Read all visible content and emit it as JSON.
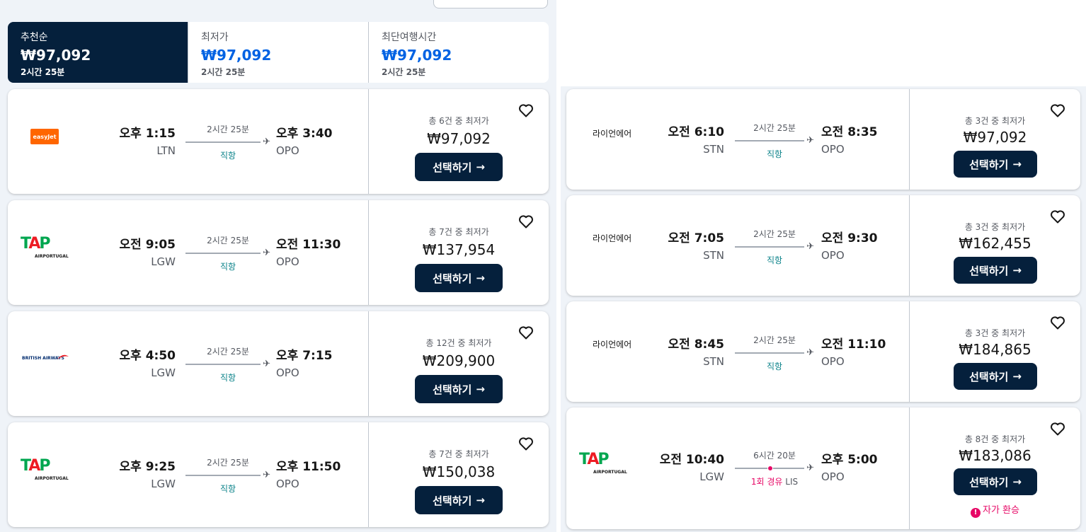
{
  "sort_tabs": [
    {
      "label": "추천순",
      "price": "₩97,092",
      "duration": "2시간 25분"
    },
    {
      "label": "최저가",
      "price": "₩97,092",
      "duration": "2시간 25분"
    },
    {
      "label": "최단여행시간",
      "price": "₩97,092",
      "duration": "2시간 25분"
    }
  ],
  "select_label": "선택하기",
  "left_flights": [
    {
      "airline": "easyJet",
      "logo": "easyjet-logo",
      "dep_time": "오후 1:15",
      "dep_airport": "LTN",
      "duration": "2시간 25분",
      "stops": "직항",
      "arr_time": "오후 3:40",
      "arr_airport": "OPO",
      "deal": "총 6건 중 최저가",
      "price": "₩97,092"
    },
    {
      "airline": "TAP",
      "logo": "tap-logo",
      "logo_sub": "AIRPORTUGAL",
      "dep_time": "오전 9:05",
      "dep_airport": "LGW",
      "duration": "2시간 25분",
      "stops": "직항",
      "arr_time": "오전 11:30",
      "arr_airport": "OPO",
      "deal": "총 7건 중 최저가",
      "price": "₩137,954"
    },
    {
      "airline": "BRITISH AIRWAYS",
      "logo": "british-airways-logo",
      "dep_time": "오후 4:50",
      "dep_airport": "LGW",
      "duration": "2시간 25분",
      "stops": "직항",
      "arr_time": "오후 7:15",
      "arr_airport": "OPO",
      "deal": "총 12건 중 최저가",
      "price": "₩209,900"
    },
    {
      "airline": "TAP",
      "logo": "tap-logo",
      "logo_sub": "AIRPORTUGAL",
      "dep_time": "오후 9:25",
      "dep_airport": "LGW",
      "duration": "2시간 25분",
      "stops": "직항",
      "arr_time": "오후 11:50",
      "arr_airport": "OPO",
      "deal": "총 7건 중 최저가",
      "price": "₩150,038"
    }
  ],
  "right_flights": [
    {
      "airline": "라이언에어",
      "dep_time": "오전 6:10",
      "dep_airport": "STN",
      "duration": "2시간 25분",
      "stops": "직항",
      "arr_time": "오전 8:35",
      "arr_airport": "OPO",
      "deal": "총 3건 중 최저가",
      "price": "₩97,092"
    },
    {
      "airline": "라이언에어",
      "dep_time": "오전 7:05",
      "dep_airport": "STN",
      "duration": "2시간 25분",
      "stops": "직항",
      "arr_time": "오전 9:30",
      "arr_airport": "OPO",
      "deal": "총 3건 중 최저가",
      "price": "₩162,455"
    },
    {
      "airline": "라이언에어",
      "dep_time": "오전 8:45",
      "dep_airport": "STN",
      "duration": "2시간 25분",
      "stops": "직항",
      "arr_time": "오전 11:10",
      "arr_airport": "OPO",
      "deal": "총 3건 중 최저가",
      "price": "₩184,865"
    },
    {
      "airline": "TAP",
      "logo": "tap-logo",
      "logo_sub": "AIRPORTUGAL",
      "dep_time": "오전 10:40",
      "dep_airport": "LGW",
      "duration": "6시간 20분",
      "stops": "1회 경유",
      "via": "LIS",
      "arr_time": "오후 5:00",
      "arr_airport": "OPO",
      "deal": "총 8건 중 최저가",
      "price": "₩183,086",
      "warning": "자가 환승"
    }
  ],
  "colors": {
    "brand_dark": "#05203c",
    "link_blue": "#0062e3",
    "direct_teal": "#0c838a",
    "layover_pink": "#e70866"
  }
}
